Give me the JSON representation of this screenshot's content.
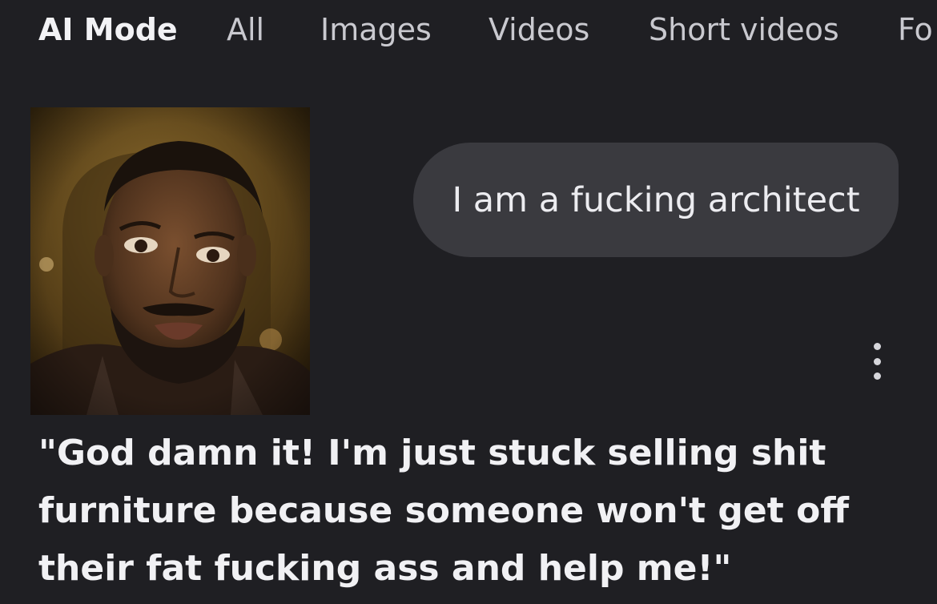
{
  "tabs": [
    {
      "label": "AI Mode",
      "active": true
    },
    {
      "label": "All"
    },
    {
      "label": "Images"
    },
    {
      "label": "Videos"
    },
    {
      "label": "Short videos"
    },
    {
      "label": "Fo"
    }
  ],
  "chat": {
    "user_message": "I am a fucking architect",
    "response_lines": [
      "\"God damn it! I'm just stuck selling shit",
      "furniture because someone won't get off",
      "their fat fucking ass and help me!\""
    ]
  },
  "icons": {
    "more": "more-vert-icon"
  },
  "colors": {
    "background": "#1f1f23",
    "bubble": "#3a3a3f",
    "text": "#f1f1f4"
  }
}
